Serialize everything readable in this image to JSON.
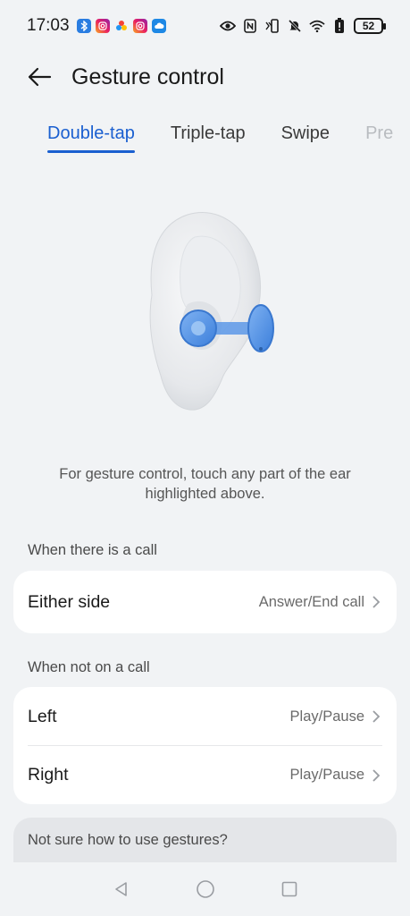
{
  "status_bar": {
    "time": "17:03",
    "battery": "52",
    "left_icons": [
      "bluetooth-app-icon",
      "instagram-icon",
      "photos-icon",
      "instagram-icon",
      "cloud-icon"
    ],
    "right_icons": [
      "eye-icon",
      "nfc-icon",
      "vibrate-icon",
      "mute-icon",
      "wifi-icon",
      "battery-alert-icon",
      "battery-icon"
    ]
  },
  "header": {
    "title": "Gesture control"
  },
  "tabs": [
    {
      "label": "Double-tap",
      "active": true
    },
    {
      "label": "Triple-tap",
      "active": false
    },
    {
      "label": "Swipe",
      "active": false
    },
    {
      "label": "Pre",
      "active": false
    }
  ],
  "illustration": {
    "accent": "#4a8ee8"
  },
  "hint": "For gesture control, touch any part of the ear highlighted above.",
  "call_section": {
    "label": "When there is a call",
    "rows": [
      {
        "title": "Either side",
        "value": "Answer/End call"
      }
    ]
  },
  "no_call_section": {
    "label": "When not on a call",
    "rows": [
      {
        "title": "Left",
        "value": "Play/Pause"
      },
      {
        "title": "Right",
        "value": "Play/Pause"
      }
    ]
  },
  "help": {
    "label": "Not sure how to use gestures?"
  },
  "colors": {
    "accent": "#1a5fd0",
    "background": "#f1f3f5",
    "card": "#ffffff"
  }
}
